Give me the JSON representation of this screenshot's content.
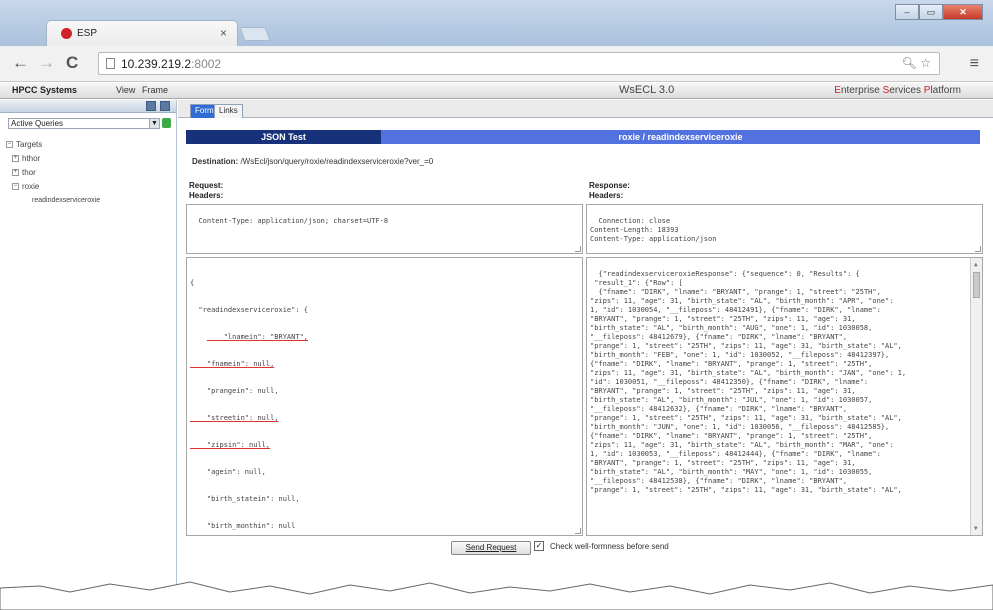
{
  "browser": {
    "tab_title": "ESP",
    "tab_close": "×",
    "url_host": "10.239.219.2",
    "url_port": ":8002",
    "omni_icons": "🔍︎ ☆",
    "menu_icon": "≡",
    "window_buttons": [
      "–",
      "▭",
      "✕"
    ]
  },
  "appbar": {
    "brand": "HPCC Systems",
    "menu": [
      "View",
      "Frame"
    ],
    "title": "WsECL 3.0",
    "esp_E": "E",
    "esp_nterprise": "nterprise ",
    "esp_S": "S",
    "esp_ervices": "ervices ",
    "esp_P": "P",
    "esp_latform": "latform"
  },
  "leftpane": {
    "select_value": "Active Queries",
    "tree": {
      "root": "Targets",
      "items": [
        "hthor",
        "thor",
        "roxie"
      ],
      "leaf": "readindexserviceroxie"
    }
  },
  "content_tabs": [
    "Form",
    "Links"
  ],
  "header": {
    "left": "JSON Test",
    "right": "roxie / readindexserviceroxie"
  },
  "destination": {
    "label": "Destination:",
    "value": " /WsEcl/json/query/roxie/readindexserviceroxie?ver_=0"
  },
  "request": {
    "label": "Request:",
    "headers_label": "Headers:",
    "headers": "Content-Type: application/json; charset=UTF-8",
    "body": [
      "{",
      "  \"readindexserviceroxie\": {",
      "    \"lnamein\": \"BRYANT\",",
      "    \"fnamein\": null,",
      "    \"prangein\": null,",
      "    \"streetin\": null,",
      "    \"zipsin\": null,",
      "    \"agein\": null,",
      "    \"birth_statein\": null,",
      "    \"birth_monthin\": null",
      "  }",
      "}"
    ]
  },
  "response": {
    "label": "Response:",
    "headers_label": "Headers:",
    "headers": "Connection: close\nContent-Length: 18393\nContent-Type: application/json",
    "body": "{\"readindexserviceroxieResponse\": {\"sequence\": 0, \"Results\": {\n \"result_1\": {\"Row\": [\n  {\"fname\": \"DIRK\", \"lname\": \"BRYANT\", \"prange\": 1, \"street\": \"25TH\",\n\"zips\": 11, \"age\": 31, \"birth_state\": \"AL\", \"birth_month\": \"APR\", \"one\":\n1, \"id\": 1030054, \"__fileposs\": 48412491}, {\"fname\": \"DIRK\", \"lname\":\n\"BRYANT\", \"prange\": 1, \"street\": \"25TH\", \"zips\": 11, \"age\": 31,\n\"birth_state\": \"AL\", \"birth_month\": \"AUG\", \"one\": 1, \"id\": 1030058,\n\"__fileposs\": 48412679}, {\"fname\": \"DIRK\", \"lname\": \"BRYANT\",\n\"prange\": 1, \"street\": \"25TH\", \"zips\": 11, \"age\": 31, \"birth_state\": \"AL\",\n\"birth_month\": \"FEB\", \"one\": 1, \"id\": 1030052, \"__fileposs\": 48412397},\n{\"fname\": \"DIRK\", \"lname\": \"BRYANT\", \"prange\": 1, \"street\": \"25TH\",\n\"zips\": 11, \"age\": 31, \"birth_state\": \"AL\", \"birth_month\": \"JAN\", \"one\": 1,\n\"id\": 1030051, \"__fileposs\": 48412350}, {\"fname\": \"DIRK\", \"lname\":\n\"BRYANT\", \"prange\": 1, \"street\": \"25TH\", \"zips\": 11, \"age\": 31,\n\"birth_state\": \"AL\", \"birth_month\": \"JUL\", \"one\": 1, \"id\": 1030057,\n\"__fileposs\": 48412632}, {\"fname\": \"DIRK\", \"lname\": \"BRYANT\",\n\"prange\": 1, \"street\": \"25TH\", \"zips\": 11, \"age\": 31, \"birth_state\": \"AL\",\n\"birth_month\": \"JUN\", \"one\": 1, \"id\": 1030056, \"__fileposs\": 48412585},\n{\"fname\": \"DIRK\", \"lname\": \"BRYANT\", \"prange\": 1, \"street\": \"25TH\",\n\"zips\": 11, \"age\": 31, \"birth_state\": \"AL\", \"birth_month\": \"MAR\", \"one\":\n1, \"id\": 1030053, \"__fileposs\": 48412444}, {\"fname\": \"DIRK\", \"lname\":\n\"BRYANT\", \"prange\": 1, \"street\": \"25TH\", \"zips\": 11, \"age\": 31,\n\"birth_state\": \"AL\", \"birth_month\": \"MAY\", \"one\": 1, \"id\": 1030055,\n\"__fileposs\": 48412538}, {\"fname\": \"DIRK\", \"lname\": \"BRYANT\",\n\"prange\": 1, \"street\": \"25TH\", \"zips\": 11, \"age\": 31, \"birth_state\": \"AL\","
  },
  "send_button": "Send Request",
  "check_label": "Check well-formness before send",
  "colors": {
    "header_dark": "#17327a",
    "header_light": "#5272e0",
    "tab_active": "#2f6bd0",
    "esp_accent": "#cc2222"
  }
}
